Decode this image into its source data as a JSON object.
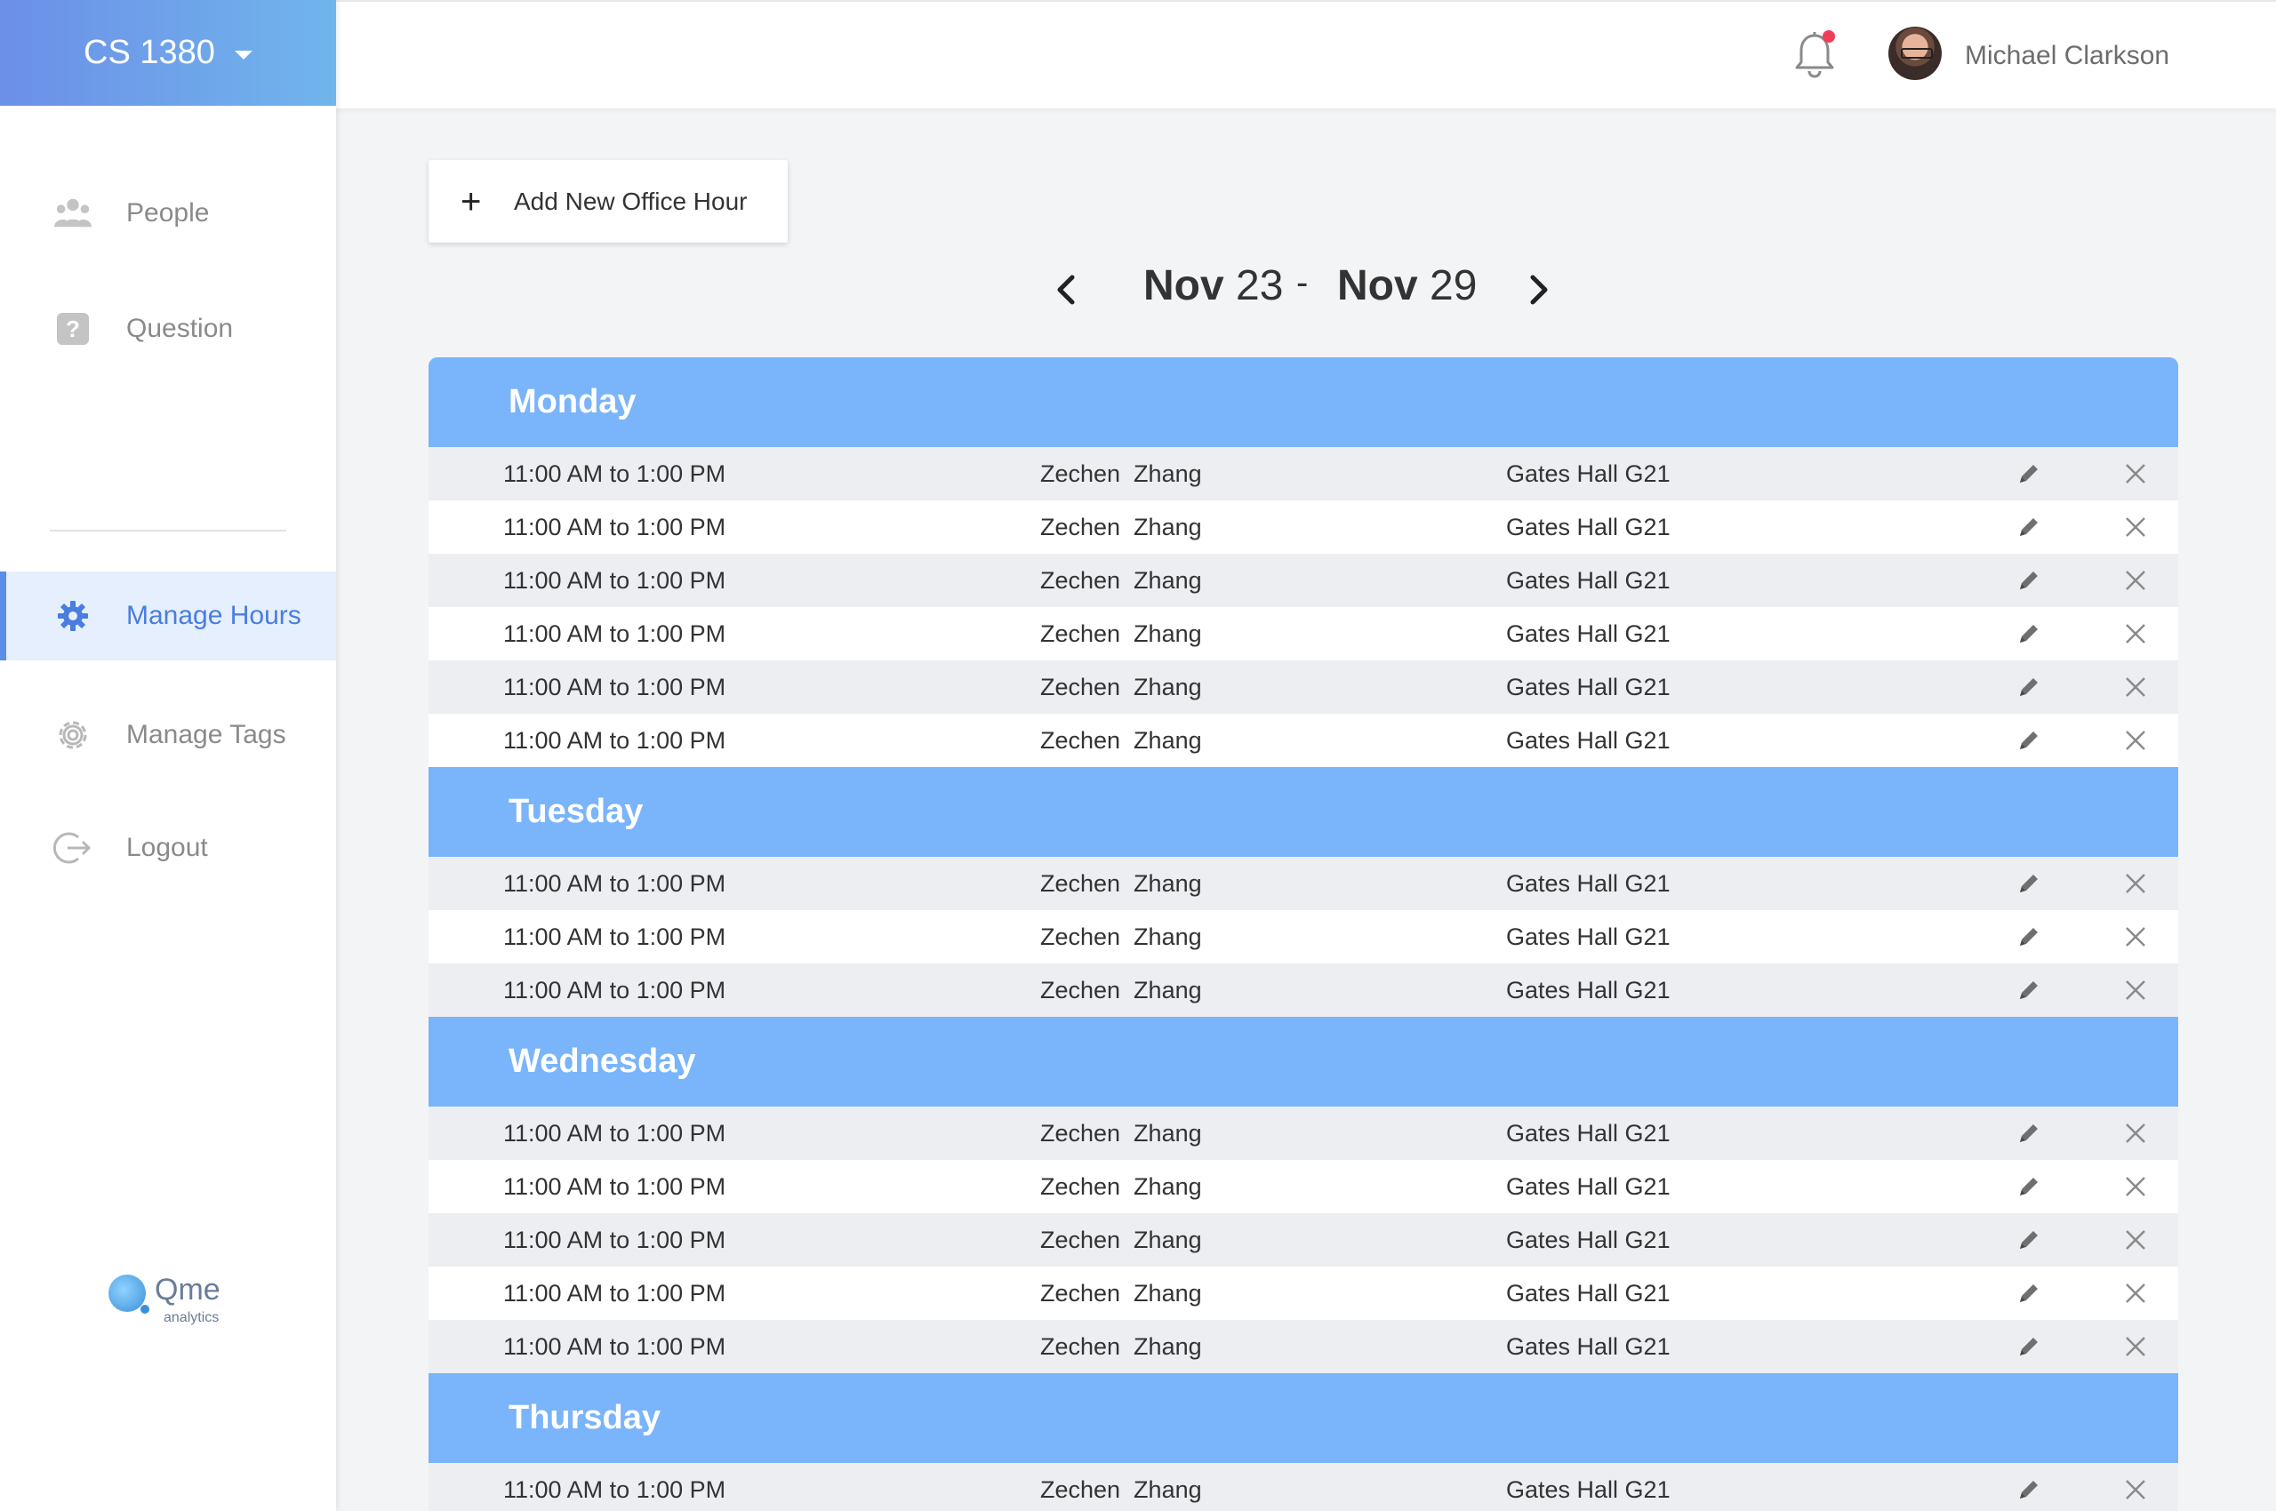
{
  "course": {
    "name": "CS 1380"
  },
  "nav": {
    "people": "People",
    "question": "Question",
    "manage_hours": "Manage Hours",
    "manage_tags": "Manage Tags",
    "logout": "Logout"
  },
  "logo": {
    "brand": "Qme",
    "sub": "analytics"
  },
  "user": {
    "name": "Michael Clarkson"
  },
  "actions": {
    "add_label": "Add New Office Hour"
  },
  "week": {
    "start_month": "Nov",
    "start_day": "23",
    "end_month": "Nov",
    "end_day": "29",
    "separator": "-"
  },
  "days": [
    {
      "name": "Monday",
      "rows": [
        {
          "time": "11:00 AM to 1:00 PM",
          "ta": "Zechen  Zhang",
          "location": "Gates Hall G21"
        },
        {
          "time": "11:00 AM to 1:00 PM",
          "ta": "Zechen  Zhang",
          "location": "Gates Hall G21"
        },
        {
          "time": "11:00 AM to 1:00 PM",
          "ta": "Zechen  Zhang",
          "location": "Gates Hall G21"
        },
        {
          "time": "11:00 AM to 1:00 PM",
          "ta": "Zechen  Zhang",
          "location": "Gates Hall G21"
        },
        {
          "time": "11:00 AM to 1:00 PM",
          "ta": "Zechen  Zhang",
          "location": "Gates Hall G21"
        },
        {
          "time": "11:00 AM to 1:00 PM",
          "ta": "Zechen  Zhang",
          "location": "Gates Hall G21"
        }
      ]
    },
    {
      "name": "Tuesday",
      "rows": [
        {
          "time": "11:00 AM to 1:00 PM",
          "ta": "Zechen  Zhang",
          "location": "Gates Hall G21"
        },
        {
          "time": "11:00 AM to 1:00 PM",
          "ta": "Zechen  Zhang",
          "location": "Gates Hall G21"
        },
        {
          "time": "11:00 AM to 1:00 PM",
          "ta": "Zechen  Zhang",
          "location": "Gates Hall G21"
        }
      ]
    },
    {
      "name": "Wednesday",
      "rows": [
        {
          "time": "11:00 AM to 1:00 PM",
          "ta": "Zechen  Zhang",
          "location": "Gates Hall G21"
        },
        {
          "time": "11:00 AM to 1:00 PM",
          "ta": "Zechen  Zhang",
          "location": "Gates Hall G21"
        },
        {
          "time": "11:00 AM to 1:00 PM",
          "ta": "Zechen  Zhang",
          "location": "Gates Hall G21"
        },
        {
          "time": "11:00 AM to 1:00 PM",
          "ta": "Zechen  Zhang",
          "location": "Gates Hall G21"
        },
        {
          "time": "11:00 AM to 1:00 PM",
          "ta": "Zechen  Zhang",
          "location": "Gates Hall G21"
        }
      ]
    },
    {
      "name": "Thursday",
      "rows": [
        {
          "time": "11:00 AM to 1:00 PM",
          "ta": "Zechen  Zhang",
          "location": "Gates Hall G21"
        }
      ]
    }
  ],
  "icons": {
    "people": "people-icon",
    "question": "question-icon",
    "manage_hours": "gear-icon",
    "manage_tags": "gear-outline-icon",
    "logout": "logout-icon",
    "bell": "bell-icon",
    "edit": "pencil-icon",
    "delete": "close-icon"
  },
  "colors": {
    "accent": "#5b8ee6",
    "day_header": "#7ab4fb",
    "notification": "#f03e5a",
    "header_gradient_start": "#6c8fe8",
    "header_gradient_end": "#70b5ec"
  }
}
